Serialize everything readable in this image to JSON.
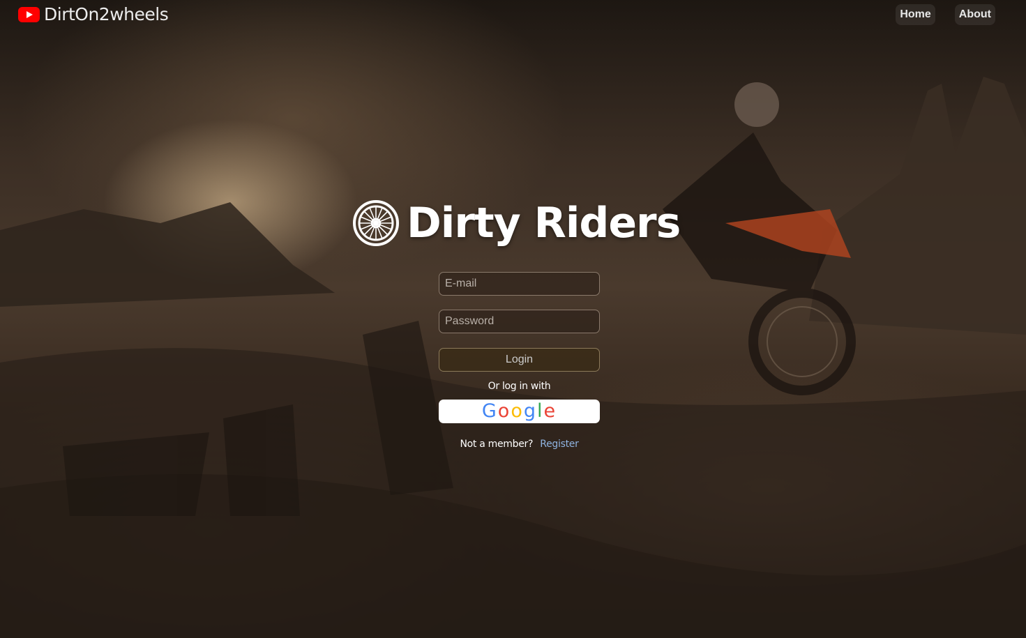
{
  "header": {
    "brand_name": "DirtOn2wheels",
    "brand_icon": "youtube-icon",
    "nav": [
      {
        "label": "Home"
      },
      {
        "label": "About"
      }
    ]
  },
  "hero": {
    "title": "Dirty Riders",
    "title_icon": "wheel-icon"
  },
  "login_form": {
    "email_placeholder": "E-mail",
    "password_placeholder": "Password",
    "login_label": "Login",
    "or_text": "Or log in with",
    "google_letters": [
      "G",
      "o",
      "o",
      "g",
      "l",
      "e"
    ],
    "not_member_text": "Not a member?",
    "register_label": "Register"
  },
  "colors": {
    "youtube_red": "#ff0000",
    "register_link": "#8fb3e0",
    "google_blue": "#4285f4",
    "google_red": "#ea4335",
    "google_yellow": "#fbbc05",
    "google_green": "#34a853"
  }
}
